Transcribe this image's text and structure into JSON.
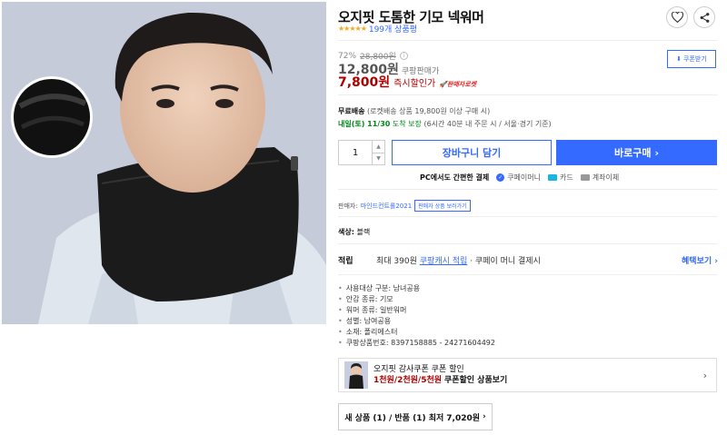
{
  "product": {
    "title": "오지핏 도톰한 기모 넥워머",
    "stars": "★★★★★",
    "review_count": "199개 상품평",
    "rating": 5
  },
  "price": {
    "discount_rate": "72%",
    "original_price": "28,800원",
    "coupang_price": "12,800원",
    "coupang_price_label": "쿠팡판매가",
    "sale_price": "7,800원",
    "sale_price_label": "즉시할인가",
    "rocket_badge": "판매자로켓",
    "coupon_button": "쿠폰받기"
  },
  "shipping": {
    "title": "무료배송",
    "condition": "(로켓배송 상품 19,800원 이상 구매 시)",
    "arrival": "내일(토) 11/30",
    "arrival_suffix": "도착 보장",
    "arrival_note": "(6시간 40분 내 주문 시 / 서울⋅경기 기준)"
  },
  "purchase": {
    "quantity": "1",
    "cart_button": "장바구니 담기",
    "buy_button": "바로구매",
    "buy_chevron": "›"
  },
  "payment": {
    "lead": "PC에서도 간편한 결제",
    "options": [
      "쿠페이머니",
      "카드",
      "계좌이체"
    ]
  },
  "seller": {
    "label": "판매자:",
    "name": "마인드컨트롤2021",
    "more_button": "판매자 상품 보러가기"
  },
  "color": {
    "label": "색상:",
    "value": "블랙"
  },
  "benefit": {
    "label": "적립",
    "text_prefix": "최대 390원",
    "link": "쿠팡캐시 적립",
    "text_suffix": "· 쿠페이 머니 결제시",
    "more": "혜택보기 ›"
  },
  "attributes": [
    "사용대상 구분: 남녀공용",
    "안감 종류: 기모",
    "워머 종류: 일반워머",
    "성별: 남여공용",
    "소재: 폴리에스터",
    "쿠팡상품번호: 8397158885 - 24271604492"
  ],
  "promo": {
    "line1": "오지핏 감사쿠폰 쿠폰 할인",
    "line2_red": "1천원/2천원/5천원",
    "line2_rest": "쿠폰할인 상품보기",
    "chevron": "›"
  },
  "new_used": {
    "label": "새 상품 (1) / 반품 (1) 최저",
    "price": "7,020원",
    "chevron": "›"
  },
  "colors": {
    "accent": "#346aff",
    "price_red": "#ae0000",
    "arrival_green": "#00891a",
    "star": "#f5a623"
  }
}
